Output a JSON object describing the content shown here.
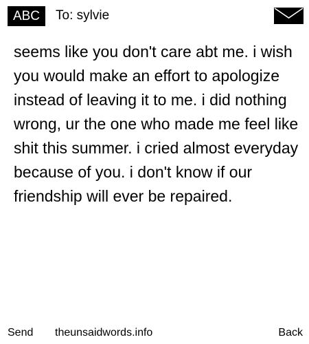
{
  "header": {
    "input_mode": "ABC",
    "recipient": "To: sylvie",
    "envelope_icon": "envelope-icon"
  },
  "message": {
    "body": "seems like you don't care abt me. i wish you would make an effort to apologize instead of leaving it to me. i did nothing wrong, ur the one who made me feel like shit this summer. i cried almost everyday because of you. i don't know if our friendship will ever be repaired."
  },
  "footer": {
    "send_label": "Send",
    "site_label": "theunsaidwords.info",
    "back_label": "Back"
  },
  "colors": {
    "background": "#ffffff",
    "text": "#000000",
    "badge_background": "#000000",
    "badge_text": "#ffffff"
  }
}
